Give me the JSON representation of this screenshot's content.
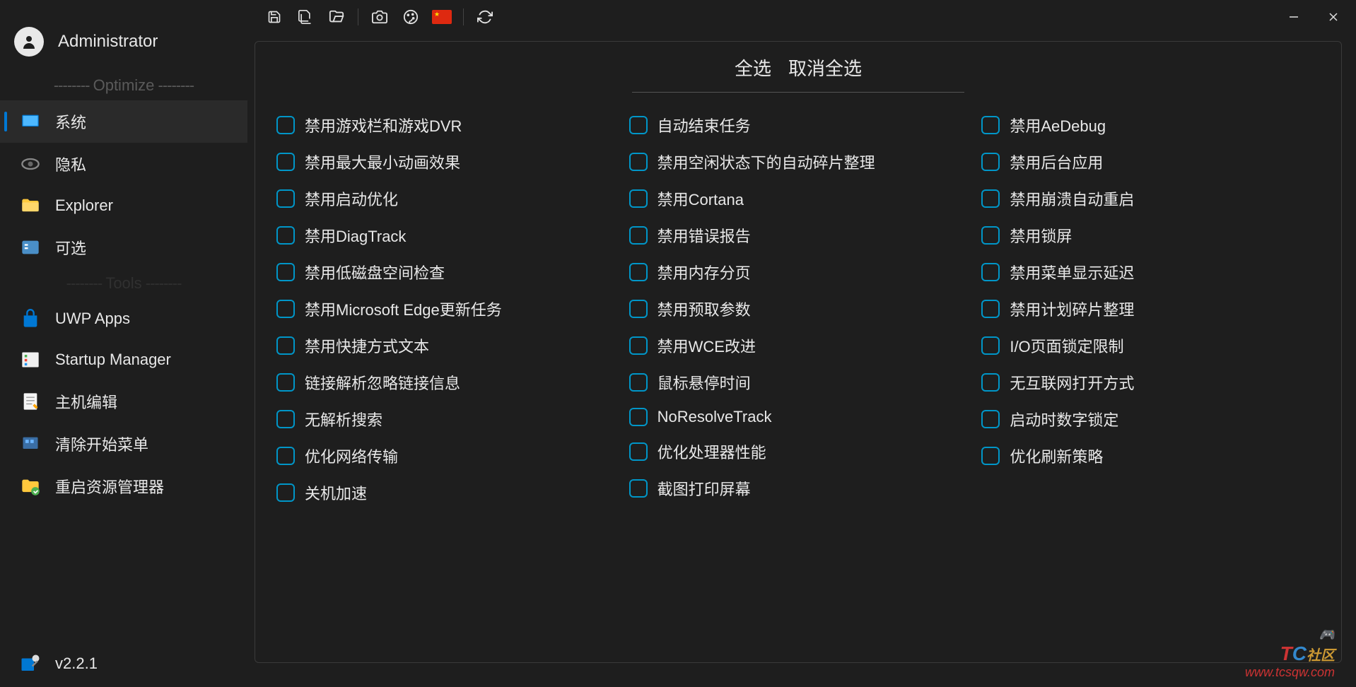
{
  "user": {
    "name": "Administrator"
  },
  "version": "v2.2.1",
  "sections": {
    "optimize": "Optimize",
    "tools": "Tools"
  },
  "nav": {
    "system": "系统",
    "privacy": "隐私",
    "explorer": "Explorer",
    "optional": "可选",
    "uwp": "UWP Apps",
    "startup": "Startup Manager",
    "hostedit": "主机编辑",
    "clearstart": "清除开始菜单",
    "restartexp": "重启资源管理器"
  },
  "header": {
    "selectAll": "全选",
    "deselectAll": "取消全选"
  },
  "options": {
    "col1": [
      "禁用游戏栏和游戏DVR",
      "禁用最大最小动画效果",
      "禁用启动优化",
      "禁用DiagTrack",
      "禁用低磁盘空间检查",
      "禁用Microsoft Edge更新任务",
      "禁用快捷方式文本",
      "链接解析忽略链接信息",
      "无解析搜索",
      "优化网络传输",
      "关机加速"
    ],
    "col2": [
      "自动结束任务",
      "禁用空闲状态下的自动碎片整理",
      "禁用Cortana",
      "禁用错误报告",
      "禁用内存分页",
      "禁用预取参数",
      "禁用WCE改进",
      "鼠标悬停时间",
      "NoResolveTrack",
      "优化处理器性能",
      "截图打印屏幕"
    ],
    "col3": [
      "禁用AeDebug",
      "禁用后台应用",
      "禁用崩溃自动重启",
      "禁用锁屏",
      "禁用菜单显示延迟",
      "禁用计划碎片整理",
      "I/O页面锁定限制",
      "无互联网打开方式",
      "启动时数字锁定",
      "优化刷新策略"
    ]
  },
  "watermark": {
    "brand_t": "T",
    "brand_c": "C",
    "brand_suffix": "社区",
    "url": "www.tcsqw.com"
  }
}
